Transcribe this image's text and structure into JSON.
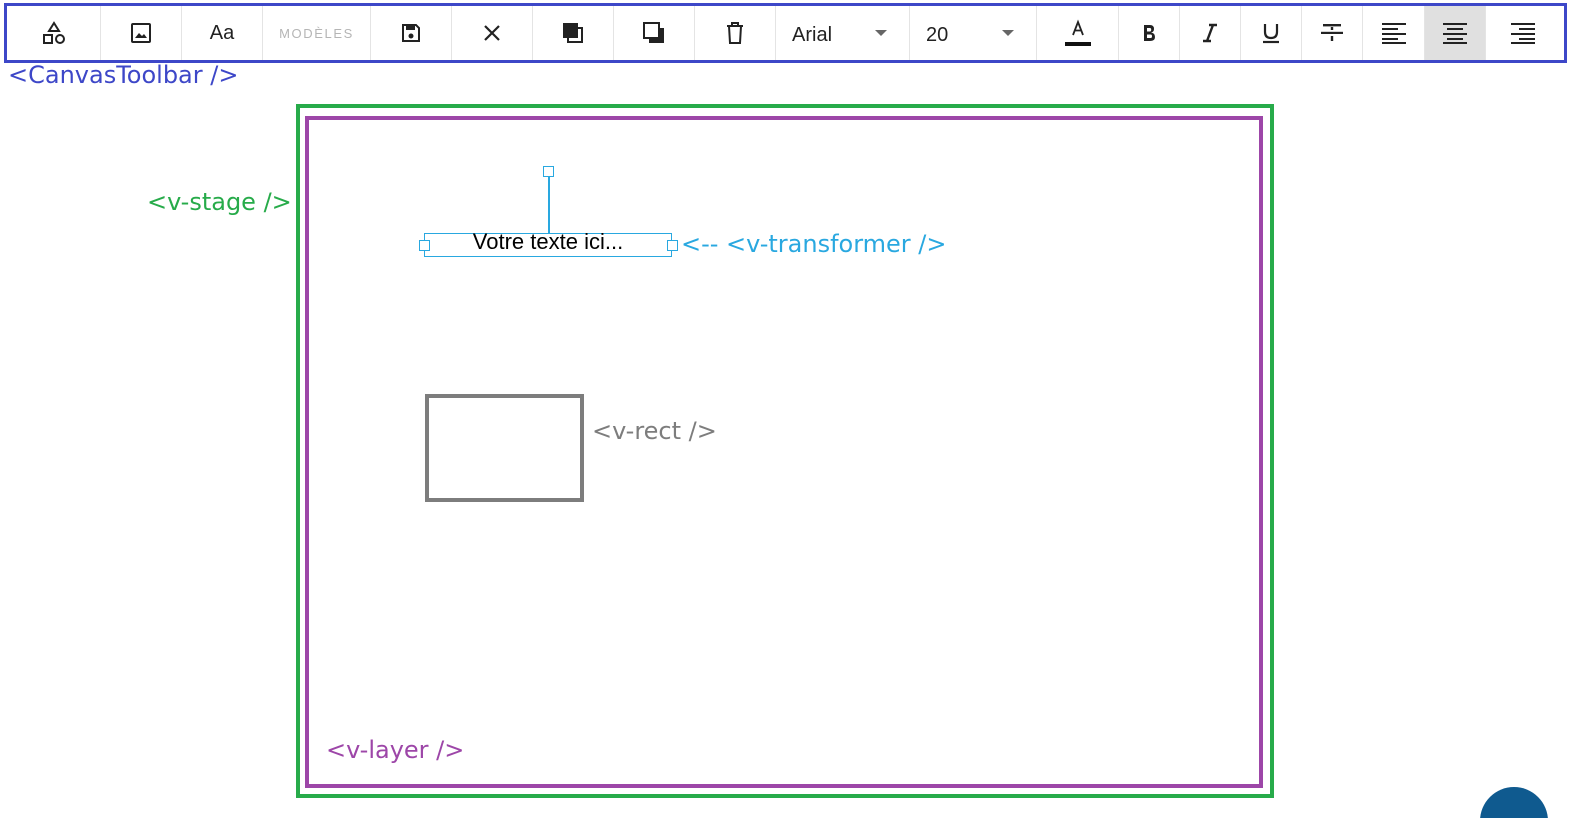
{
  "toolbar": {
    "component_label": "<CanvasToolbar />",
    "aa_label": "Aa",
    "modeles_label": "MODÈLES",
    "font_family": "Arial",
    "font_size": "20",
    "accent_color": "#3d47c8",
    "buttons": [
      {
        "name": "shapes-icon"
      },
      {
        "name": "image-icon"
      },
      {
        "name": "text-icon"
      },
      {
        "name": "modeles-button"
      },
      {
        "name": "save-icon"
      },
      {
        "name": "close-icon"
      },
      {
        "name": "bring-forward-icon"
      },
      {
        "name": "send-backward-icon"
      },
      {
        "name": "delete-icon"
      },
      {
        "name": "font-color-icon"
      },
      {
        "name": "bold-icon"
      },
      {
        "name": "italic-icon"
      },
      {
        "name": "underline-icon"
      },
      {
        "name": "strikethrough-icon"
      },
      {
        "name": "align-left-icon"
      },
      {
        "name": "align-center-icon",
        "active": true
      },
      {
        "name": "align-right-icon"
      }
    ]
  },
  "labels": {
    "stage": "<v-stage />",
    "layer": "<v-layer />",
    "transformer": "<-- <v-transformer />",
    "rect": "<v-rect />"
  },
  "canvas": {
    "text": "Votre texte ici..."
  },
  "colors": {
    "toolbar_border": "#3d47c8",
    "stage_border": "#27ab4a",
    "layer_border": "#9d46a8",
    "transformer": "#29a8e0",
    "rect": "#7d7d7d",
    "fab": "#0f5a8f"
  }
}
